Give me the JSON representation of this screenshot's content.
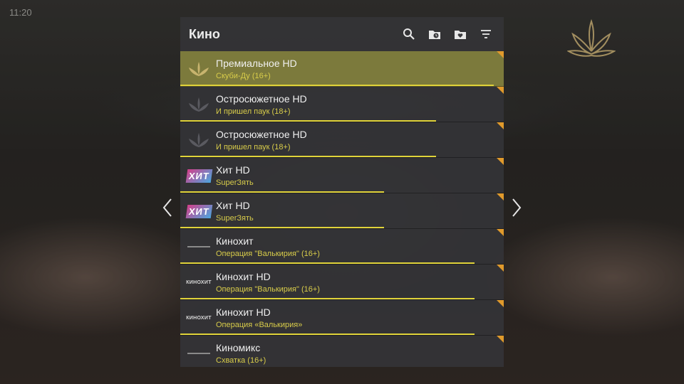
{
  "status": {
    "clock": "11:20"
  },
  "header": {
    "title": "Кино"
  },
  "icons": {
    "search": "search-icon",
    "folder_clock": "folder-clock-icon",
    "folder_heart": "folder-heart-icon",
    "filter": "filter-icon",
    "prev": "chevron-left-icon",
    "next": "chevron-right-icon",
    "brand": "crown-leaf-logo"
  },
  "colors": {
    "accent": "#e0d33a",
    "selected_bg": "#7c7a3c",
    "corner": "#e09a2c",
    "program_text": "#d8cc4a"
  },
  "channels": [
    {
      "name": "Премиальное HD",
      "program": "Скуби-Ду (16+)",
      "logo": "premium-leaf-logo",
      "progress": 0.97,
      "selected": true
    },
    {
      "name": "Остросюжетное HD",
      "program": "И пришел паук (18+)",
      "logo": "action-leaf-logo",
      "progress": 0.79
    },
    {
      "name": "Остросюжетное HD",
      "program": "И пришел паук (18+)",
      "logo": "action-leaf-logo",
      "progress": 0.79
    },
    {
      "name": "Хит HD",
      "program": "SuperЗять",
      "logo": "hit-logo",
      "logo_text": "ХИТ",
      "progress": 0.63
    },
    {
      "name": "Хит HD",
      "program": "SuperЗять",
      "logo": "hit-logo",
      "logo_text": "ХИТ",
      "progress": 0.63
    },
    {
      "name": "Кинохит",
      "program": "Операция \"Валькирия\" (16+)",
      "logo": "kinohit-logo",
      "progress": 0.91
    },
    {
      "name": "Кинохит HD",
      "program": "Операция \"Валькирия\" (16+)",
      "logo": "kinohit-logo",
      "logo_text": "КИНОХИТ",
      "progress": 0.91
    },
    {
      "name": "Кинохит HD",
      "program": "Операция «Валькирия»",
      "logo": "kinohit-logo",
      "logo_text": "КИНОХИТ",
      "progress": 0.91
    },
    {
      "name": "Киномикс",
      "program": "Схватка (16+)",
      "logo": "kinomix-logo",
      "progress": 0.0
    }
  ]
}
